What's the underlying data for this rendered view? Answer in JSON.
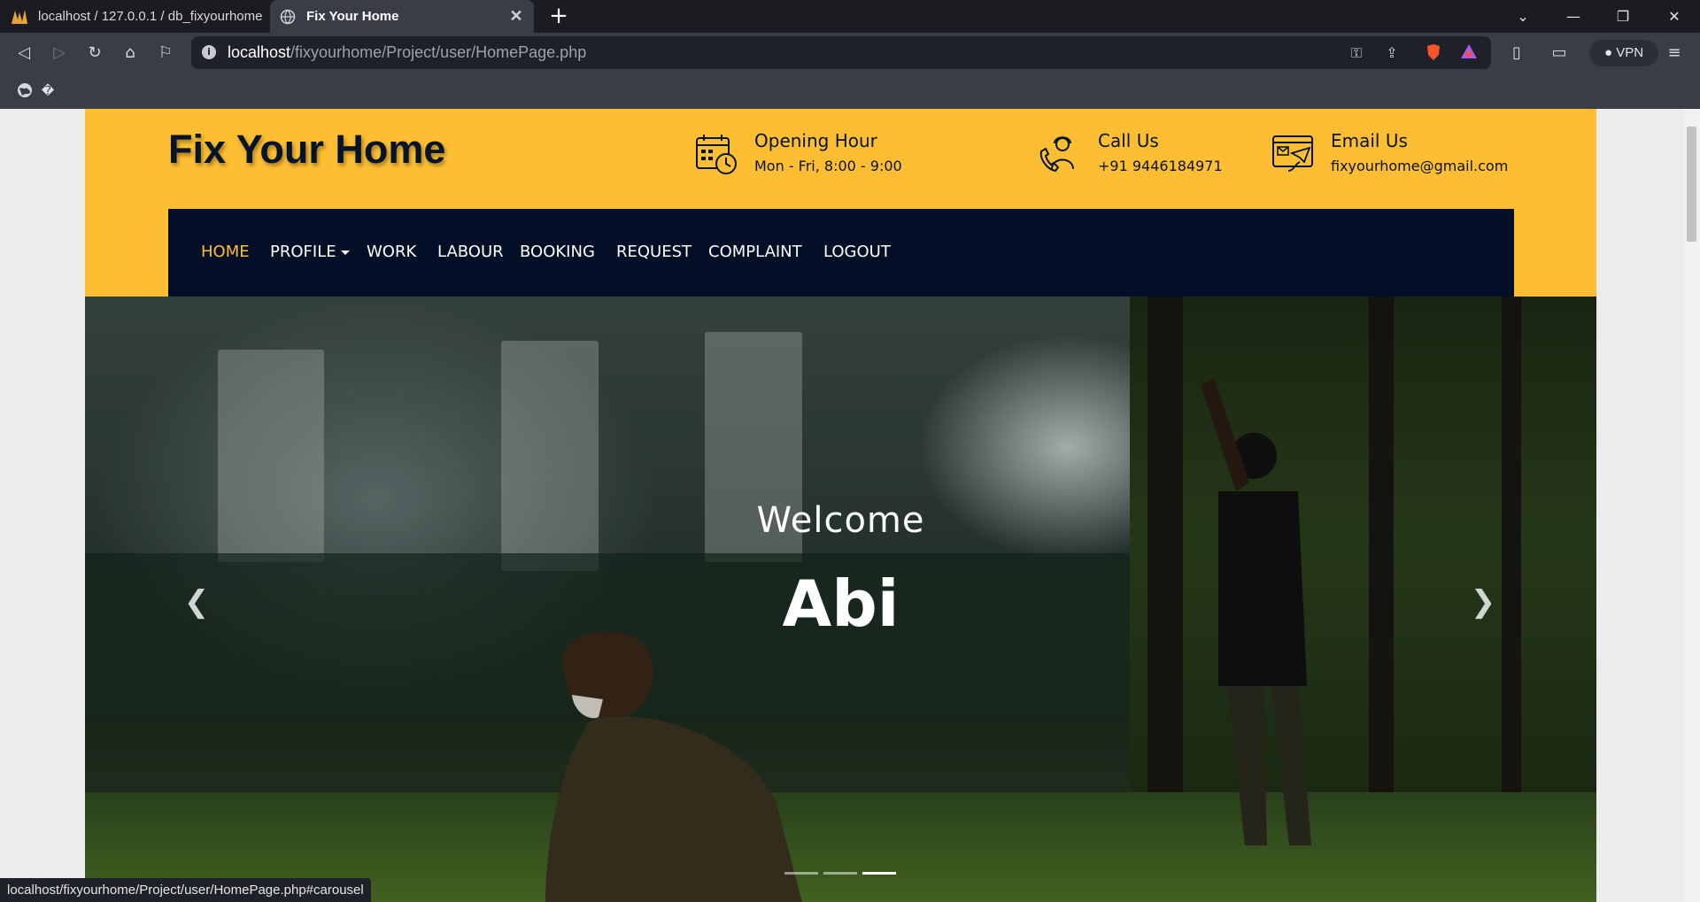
{
  "browser": {
    "tabs": [
      {
        "title": "localhost / 127.0.0.1 / db_fixyourhome",
        "active": false
      },
      {
        "title": "Fix Your Home",
        "active": true
      }
    ],
    "url_host": "localhost",
    "url_path": "/fixyourhome/Project/user/HomePage.php",
    "vpn_label": "VPN",
    "bookmark_glyph": "�",
    "status_url": "localhost/fixyourhome/Project/user/HomePage.php#carousel"
  },
  "site": {
    "brand": "Fix Your Home",
    "info": [
      {
        "icon": "calendar-clock-icon",
        "title": "Opening Hour",
        "subtitle": "Mon - Fri, 8:00 - 9:00"
      },
      {
        "icon": "support-agent-icon",
        "title": "Call Us",
        "subtitle": "+91 9446184971"
      },
      {
        "icon": "email-icon",
        "title": "Email Us",
        "subtitle": "fixyourhome@gmail.com"
      }
    ],
    "nav": [
      {
        "label": "HOME",
        "active": true
      },
      {
        "label": "PROFILE",
        "dropdown": true
      },
      {
        "label": "WORK"
      },
      {
        "label": "LABOUR"
      },
      {
        "label": "BOOKING"
      },
      {
        "label": "REQUEST"
      },
      {
        "label": "COMPLAINT"
      },
      {
        "label": "LOGOUT"
      }
    ],
    "hero": {
      "welcome": "Welcome",
      "name": "Abi",
      "slide_count": 3,
      "active_slide": 3
    }
  },
  "colors": {
    "accent": "#fdbe33",
    "navbar": "#030f27",
    "brand_text": "#061429"
  }
}
